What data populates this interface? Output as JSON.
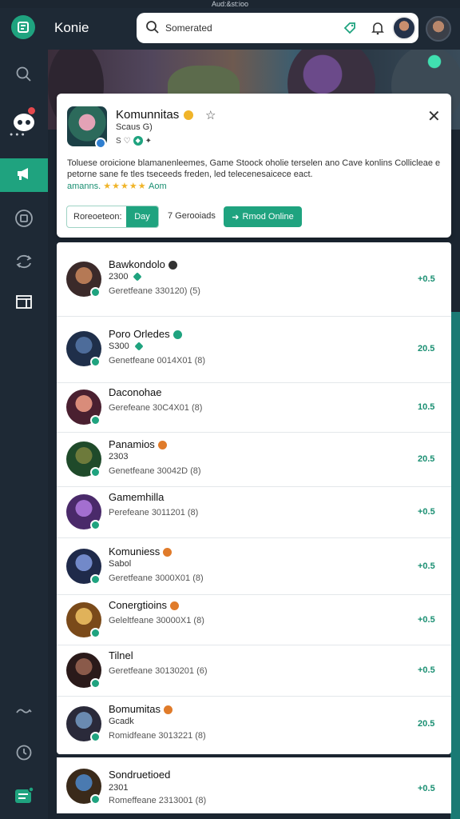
{
  "window": {
    "title": "Aud:&st:ioo"
  },
  "header": {
    "app_name": "Konie",
    "search_placeholder": "Somerated"
  },
  "card": {
    "title": "Komunnitas",
    "subtitle": "Scaus G)",
    "mini_text": "S",
    "description": "Toluese oroicione blamanenleemes, Game Stoock oholie terselen ano Cave konlins Collicleae e petorne sane fe tles tseceeds freden, led telecenesaicece eact.",
    "rating_label": "amanns.",
    "rating_stars": "★★★★★",
    "rating_suffix": "Aom",
    "range_label": "Roreoeteon:",
    "range_value": "Day",
    "count_text": "7 Gerooiads",
    "join_label": "Rmod Online"
  },
  "members": [
    {
      "name": "Bawkondolo",
      "badge_color": "#333333",
      "stat": "2300",
      "meta": "Geretfeane 330120) (5)",
      "delta": "+0.5",
      "avatar_colors": [
        "#b57955",
        "#3b2a2a"
      ]
    },
    {
      "name": "Poro Orledes",
      "badge_color": "#1fa37f",
      "stat": "S300",
      "meta": "Genetfeane 0014X01 (8)",
      "delta": "20.5",
      "avatar_colors": [
        "#4d6c9a",
        "#1f2f4a"
      ]
    },
    {
      "name": "Daconohae",
      "badge_color": "",
      "stat": "",
      "meta": "Gerefeane 30C4X01 (8)",
      "delta": "10.5",
      "avatar_colors": [
        "#d98c7a",
        "#4a2030"
      ]
    },
    {
      "name": "Panamios",
      "badge_color": "#e07b2a",
      "stat": "2303",
      "meta": "Genetfeane 30042D (8)",
      "delta": "20.5",
      "avatar_colors": [
        "#6d7a3b",
        "#1f4a2a"
      ]
    },
    {
      "name": "Gamemhilla",
      "badge_color": "",
      "stat": "",
      "meta": "Perefeane 3011201 (8)",
      "delta": "+0.5",
      "avatar_colors": [
        "#a36fd0",
        "#4a2a6a"
      ]
    },
    {
      "name": "Komuniess",
      "badge_color": "#e07b2a",
      "stat": "Sabol",
      "meta": "Geretfeane 3000X01 (8)",
      "delta": "+0.5",
      "avatar_colors": [
        "#7289c9",
        "#1f2a4a"
      ]
    },
    {
      "name": "Conergtioins",
      "badge_color": "#e07b2a",
      "stat": "",
      "meta": "Geleltfeane 30000X1 (8)",
      "delta": "+0.5",
      "avatar_colors": [
        "#e0b25a",
        "#7a4a1a"
      ]
    },
    {
      "name": "Tilnel",
      "badge_color": "",
      "stat": "",
      "meta": "Geretfeane 30130201 (6)",
      "delta": "+0.5",
      "avatar_colors": [
        "#8a5a4a",
        "#2a1a1a"
      ]
    },
    {
      "name": "Bomumitas",
      "badge_color": "#e07b2a",
      "stat": "Gcadk",
      "meta": "Romidfeane 3013221 (8)",
      "delta": "20.5",
      "avatar_colors": [
        "#6a8ab0",
        "#2a2a3a"
      ]
    }
  ],
  "last_member": {
    "name": "Sondruetioed",
    "stat": "2301",
    "meta": "Romeffeane 2313001 (8)",
    "delta": "+0.5",
    "avatar_colors": [
      "#4a7ab0",
      "#3a2a1a"
    ]
  }
}
